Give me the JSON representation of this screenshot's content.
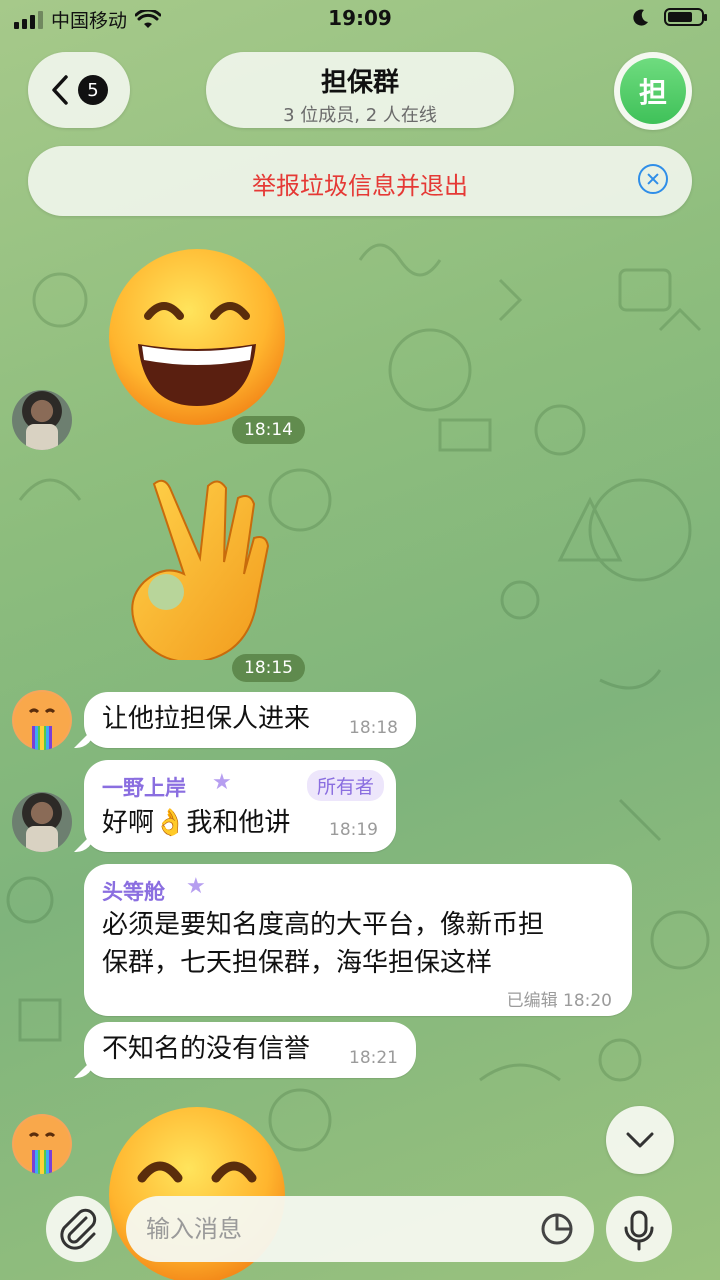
{
  "status_bar": {
    "carrier": "中国移动",
    "time": "19:09",
    "battery_level": 0.75
  },
  "header": {
    "back_badge": "5",
    "title": "担保群",
    "subtitle": "3 位成员, 2 人在线",
    "avatar_letter": "担"
  },
  "report_banner": {
    "label": "举报垃圾信息并退出"
  },
  "messages": [
    {
      "type": "sticker",
      "emoji": "grinning-face",
      "time": "18:14"
    },
    {
      "type": "sticker",
      "emoji": "ok-hand",
      "time": "18:15"
    },
    {
      "type": "text",
      "text": "让他拉担保人进来",
      "time": "18:18"
    },
    {
      "type": "text",
      "sender": "一野上岸",
      "role": "所有者",
      "text": "好啊👌我和他讲",
      "time": "18:19"
    },
    {
      "type": "text",
      "sender": "头等舱",
      "text_line1": "必须是要知名度高的大平台，像新币担",
      "text_line2": "保群，七天担保群，海华担保这样",
      "time": "已编辑 18:20"
    },
    {
      "type": "text",
      "text": "不知名的没有信誉",
      "time": "18:21"
    },
    {
      "type": "sticker",
      "emoji": "grinning-face-partial"
    }
  ],
  "composer": {
    "placeholder": "输入消息"
  },
  "icons": [
    "back-chevron-icon",
    "close-circle-icon",
    "chevron-down-icon",
    "paperclip-icon",
    "sticker-icon",
    "microphone-icon",
    "wifi-icon",
    "moon-icon"
  ]
}
